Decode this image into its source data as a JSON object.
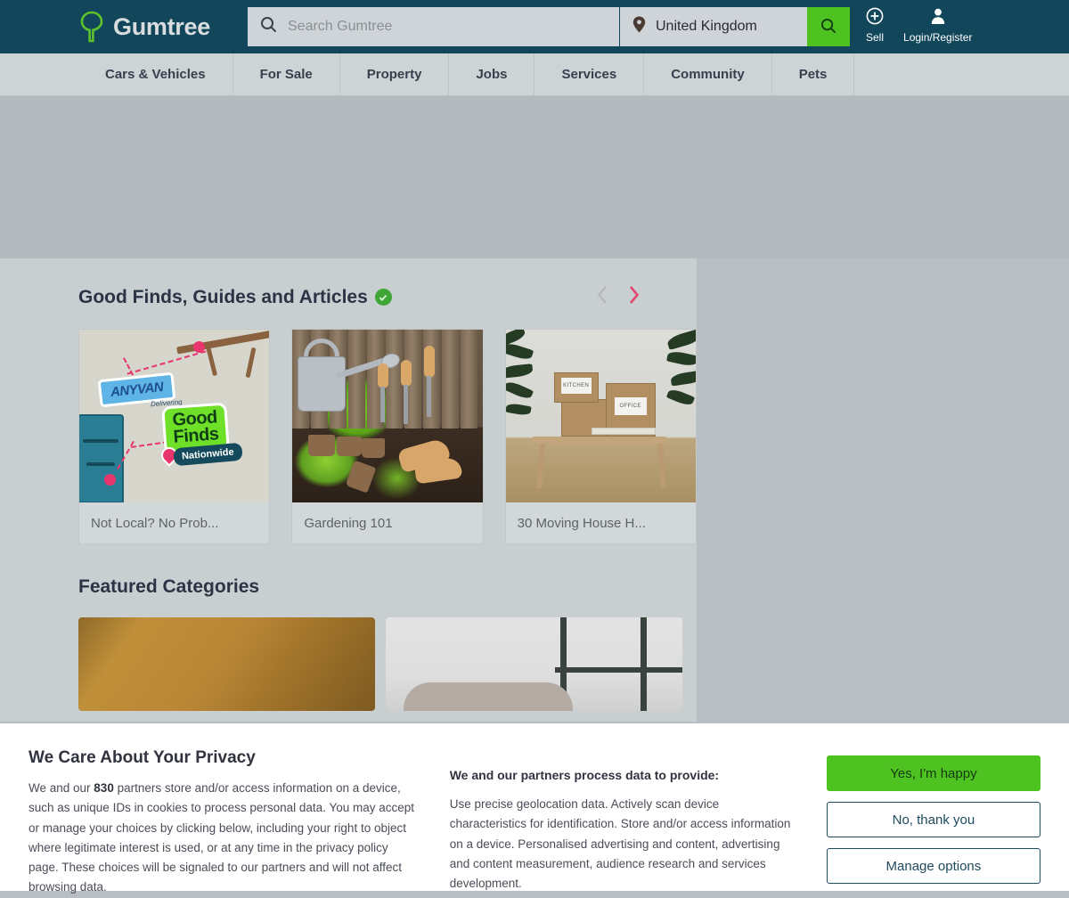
{
  "header": {
    "brand": "Gumtree",
    "logo_icon": "tree-icon",
    "accent_green": "#4ec220",
    "bar_color": "#12475b",
    "search": {
      "icon": "search-icon",
      "placeholder": "Search Gumtree",
      "value": "",
      "location_icon": "location-pin-icon",
      "location_value": "United Kingdom",
      "submit_icon": "search-icon"
    },
    "actions": [
      {
        "label": "Sell",
        "icon": "plus-circle-icon"
      },
      {
        "label": "Login/Register",
        "icon": "user-icon"
      }
    ]
  },
  "nav": {
    "items": [
      {
        "label": "Cars & Vehicles"
      },
      {
        "label": "For Sale"
      },
      {
        "label": "Property"
      },
      {
        "label": "Jobs"
      },
      {
        "label": "Services"
      },
      {
        "label": "Community"
      },
      {
        "label": "Pets"
      }
    ]
  },
  "main": {
    "good_finds": {
      "title": "Good Finds, Guides and Articles",
      "badge_icon": "verified-check-icon",
      "badge_color": "#3fa535",
      "prev_icon": "chevron-left-icon",
      "next_icon": "chevron-right-icon",
      "next_color": "#e0486c",
      "cards": [
        {
          "label": "Not Local? No Prob...",
          "image": "anyvan-good-finds-nationwide-illustration",
          "art": {
            "brand": "ANYVAN",
            "delivering": "Delivering",
            "good": "Good",
            "finds": "Finds",
            "nationwide": "Nationwide"
          }
        },
        {
          "label": "Gardening 101",
          "image": "gardening-tools-and-seedlings-photo"
        },
        {
          "label": "30 Moving House H...",
          "image": "moving-boxes-on-table-photo",
          "art": {
            "tag1": "KITCHEN",
            "tag2": "OFFICE"
          }
        }
      ]
    },
    "featured_categories": {
      "title": "Featured Categories",
      "cards": [
        {
          "image": "person-in-mustard-knit-jumper-photo"
        },
        {
          "image": "living-room-shelf-and-sofa-photo"
        }
      ]
    }
  },
  "privacy": {
    "title": "We Care About Your Privacy",
    "body_before": "We and our ",
    "partner_count": "830",
    "body_after": " partners store and/or access information on a device, such as unique IDs in cookies to process personal data. You may accept or manage your choices by clicking below, including your right to object where legitimate interest is used, or at any time in the privacy policy page. These choices will be signaled to our partners and will not affect browsing data.",
    "purposes_title": "We and our partners process data to provide:",
    "purposes_body": "Use precise geolocation data. Actively scan device characteristics for identification. Store and/or access information on a device. Personalised advertising and content, advertising and content measurement, audience research and services development.",
    "buttons": {
      "accept": "Yes, I'm happy",
      "reject": "No, thank you",
      "manage": "Manage options"
    }
  }
}
